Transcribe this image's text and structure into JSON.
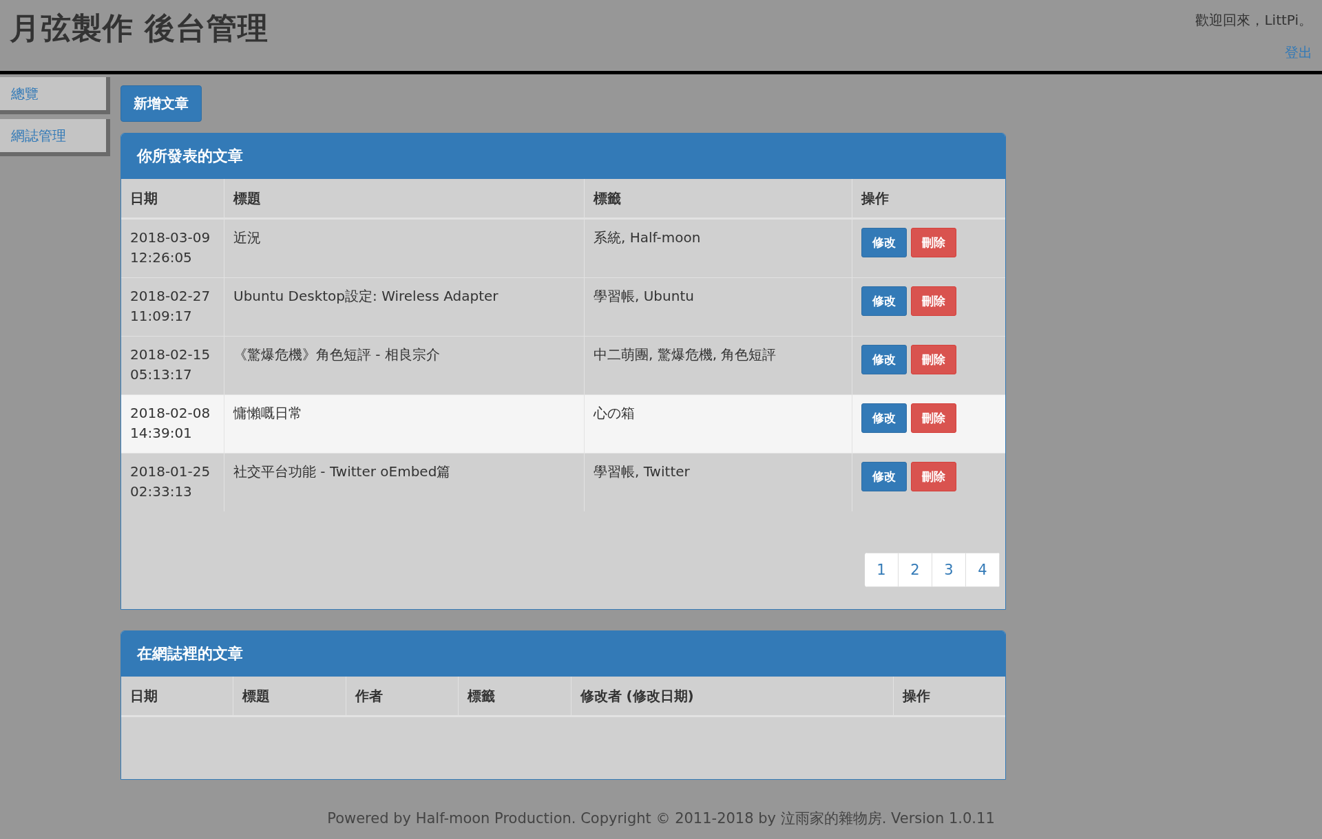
{
  "header": {
    "title": "月弦製作 後台管理",
    "welcome": "歡迎回來，LittPi。",
    "logout": "登出"
  },
  "sidebar": {
    "items": [
      "總覽",
      "網誌管理"
    ]
  },
  "new_post_button": "新增文章",
  "my_posts": {
    "title": "你所發表的文章",
    "columns": [
      "日期",
      "標題",
      "標籤",
      "操作"
    ],
    "rows": [
      {
        "date": "2018-03-09",
        "time": "12:26:05",
        "title": "近況",
        "tags": "系統, Half-moon",
        "edit": "修改",
        "delete": "刪除",
        "highlighted": false
      },
      {
        "date": "2018-02-27",
        "time": "11:09:17",
        "title": "Ubuntu Desktop設定: Wireless Adapter",
        "tags": "學習帳, Ubuntu",
        "edit": "修改",
        "delete": "刪除",
        "highlighted": false
      },
      {
        "date": "2018-02-15",
        "time": "05:13:17",
        "title": "《驚爆危機》角色短評 - 相良宗介",
        "tags": "中二萌團, 驚爆危機, 角色短評",
        "edit": "修改",
        "delete": "刪除",
        "highlighted": false
      },
      {
        "date": "2018-02-08",
        "time": "14:39:01",
        "title": "慵懶嘅日常",
        "tags": "心の箱",
        "edit": "修改",
        "delete": "刪除",
        "highlighted": true
      },
      {
        "date": "2018-01-25",
        "time": "02:33:13",
        "title": "社交平台功能 - Twitter oEmbed篇",
        "tags": "學習帳, Twitter",
        "edit": "修改",
        "delete": "刪除",
        "highlighted": false
      }
    ],
    "pages": [
      "1",
      "2",
      "3",
      "4"
    ]
  },
  "blog_posts": {
    "title": "在網誌裡的文章",
    "columns": [
      "日期",
      "標題",
      "作者",
      "標籤",
      "修改者 (修改日期)",
      "操作"
    ]
  },
  "footer": "Powered by Half-moon Production. Copyright © 2011-2018 by 泣雨家的雜物房. Version 1.0.11"
}
